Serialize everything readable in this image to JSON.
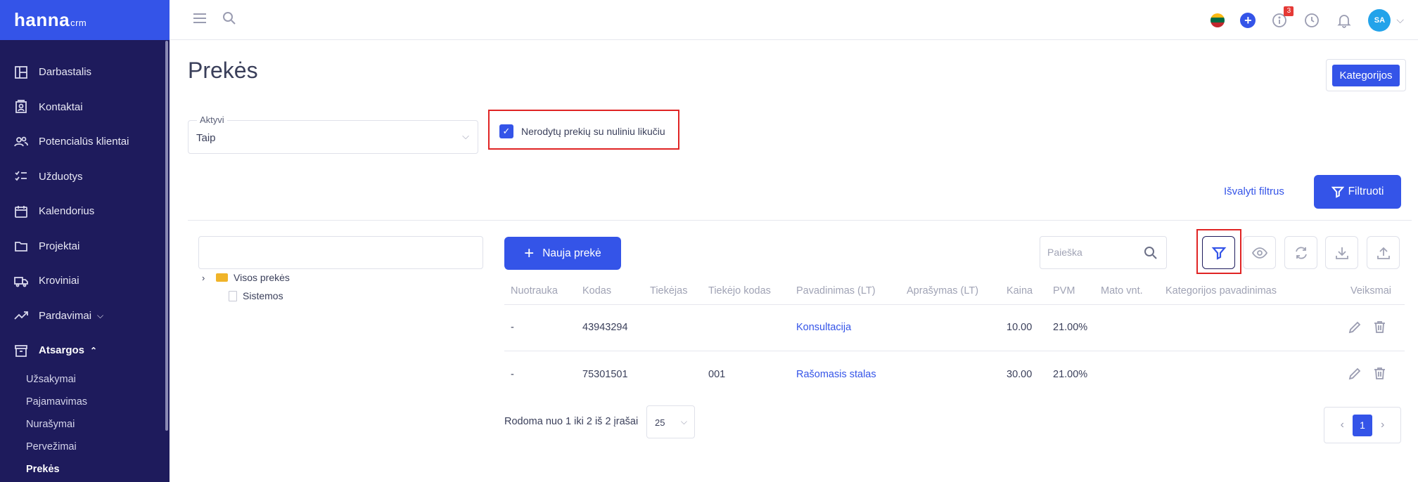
{
  "brand": {
    "name": "hanna",
    "suffix": "crm"
  },
  "sidebar": {
    "items": [
      {
        "label": "Darbastalis",
        "icon": "dashboard-icon"
      },
      {
        "label": "Kontaktai",
        "icon": "contacts-icon"
      },
      {
        "label": "Potencialūs klientai",
        "icon": "users-icon"
      },
      {
        "label": "Užduotys",
        "icon": "tasks-icon"
      },
      {
        "label": "Kalendorius",
        "icon": "calendar-icon"
      },
      {
        "label": "Projektai",
        "icon": "folder-icon"
      },
      {
        "label": "Kroviniai",
        "icon": "truck-icon"
      },
      {
        "label": "Pardavimai",
        "icon": "trend-icon"
      },
      {
        "label": "Atsargos",
        "icon": "archive-icon"
      }
    ],
    "sub_items": [
      "Užsakymai",
      "Pajamavimas",
      "Nurašymai",
      "Pervežimai",
      "Prekės"
    ],
    "active_sub": "Prekės"
  },
  "topbar": {
    "notification_badge": "3",
    "avatar_initials": "SA"
  },
  "page": {
    "title": "Prekės",
    "categories_button": "Kategorijos"
  },
  "filters": {
    "active_label": "Aktyvi",
    "active_value": "Taip",
    "hide_zero_label": "Nerodytų prekių su nuliniu likučiu",
    "hide_zero_checked": true,
    "clear_label": "Išvalyti filtrus",
    "apply_label": "Filtruoti"
  },
  "tree": {
    "root": "Visos prekės",
    "children": [
      "Sistemos"
    ]
  },
  "toolbar": {
    "new_label": "Nauja prekė",
    "search_placeholder": "Paieška"
  },
  "table": {
    "headers": [
      "Nuotrauka",
      "Kodas",
      "Tiekėjas",
      "Tiekėjo kodas",
      "Pavadinimas (LT)",
      "Aprašymas (LT)",
      "Kaina",
      "PVM",
      "Mato vnt.",
      "Kategorijos pavadinimas",
      "Veiksmai"
    ],
    "rows": [
      {
        "photo": "-",
        "code": "43943294",
        "supplier": "",
        "supplier_code": "",
        "name": "Konsultacija",
        "desc": "",
        "price": "10.00",
        "vat": "21.00%",
        "unit": "",
        "category": ""
      },
      {
        "photo": "-",
        "code": "75301501",
        "supplier": "",
        "supplier_code": "001",
        "name": "Rašomasis stalas",
        "desc": "",
        "price": "30.00",
        "vat": "21.00%",
        "unit": "",
        "category": ""
      }
    ]
  },
  "footer": {
    "summary": "Rodoma nuo 1 iki 2 iš 2 įrašai",
    "page_size": "25",
    "current_page": "1"
  },
  "colors": {
    "sidebar_bg": "#1e1b5c",
    "accent": "#3454e8",
    "highlight": "#e02424"
  }
}
